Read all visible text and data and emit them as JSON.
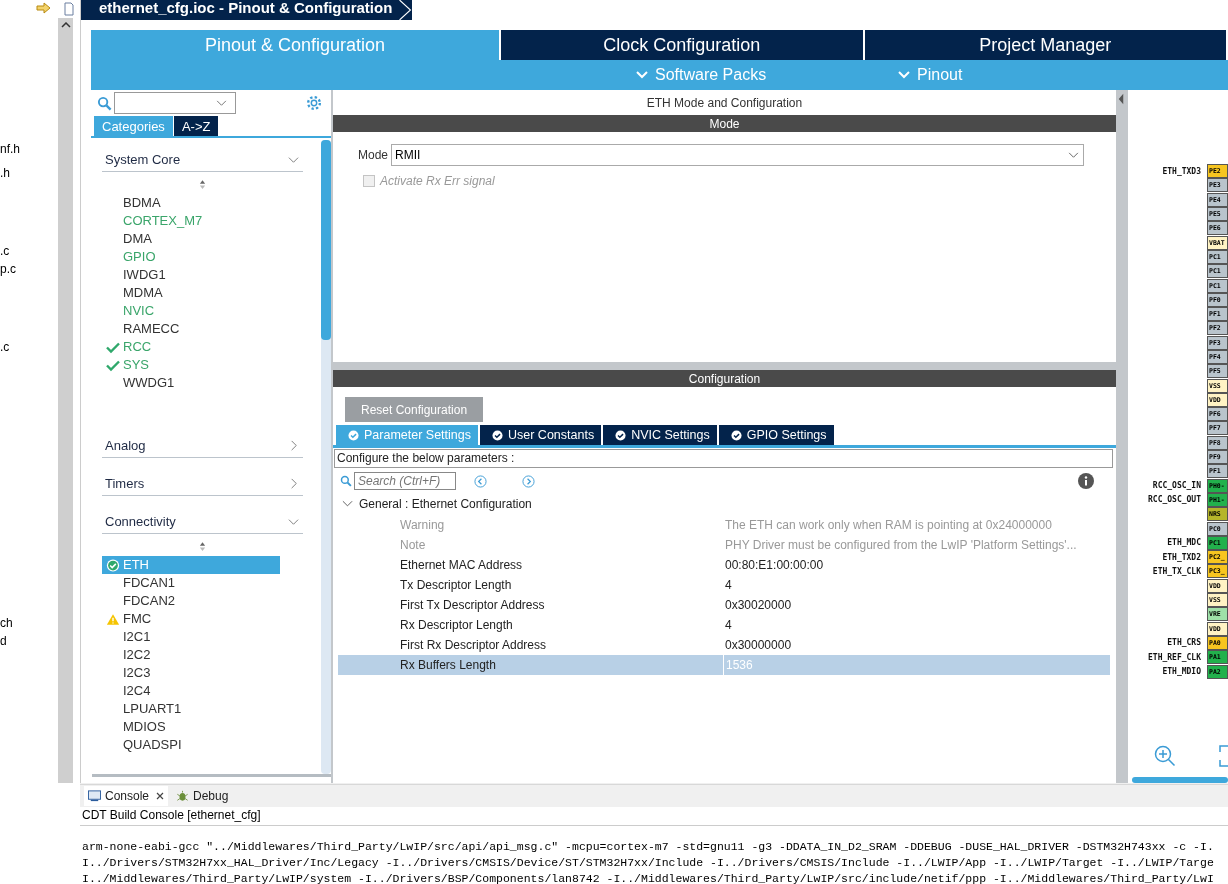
{
  "explorer": {
    "files": [
      "nf.h",
      ".h",
      ".c",
      "p.c",
      ".c",
      "ch",
      "d"
    ]
  },
  "window": {
    "title": "ethernet_cfg.ioc - Pinout & Configuration"
  },
  "tabs": [
    {
      "label": "Pinout & Configuration",
      "selected": true
    },
    {
      "label": "Clock Configuration",
      "selected": false
    },
    {
      "label": "Project Manager",
      "selected": false
    }
  ],
  "subtabs": [
    "Software Packs",
    "Pinout"
  ],
  "sidebar": {
    "view_tabs": [
      {
        "label": "Categories",
        "selected": true
      },
      {
        "label": "A->Z",
        "selected": false
      }
    ],
    "categories": [
      {
        "label": "System Core",
        "expanded": true,
        "items": [
          {
            "label": "BDMA",
            "kind": "plain",
            "selected": false
          },
          {
            "label": "CORTEX_M7",
            "kind": "green",
            "selected": false
          },
          {
            "label": "DMA",
            "kind": "plain",
            "selected": false
          },
          {
            "label": "GPIO",
            "kind": "green",
            "selected": false
          },
          {
            "label": "IWDG1",
            "kind": "plain",
            "selected": false
          },
          {
            "label": "MDMA",
            "kind": "plain",
            "selected": false
          },
          {
            "label": "NVIC",
            "kind": "green",
            "selected": false
          },
          {
            "label": "RAMECC",
            "kind": "plain",
            "selected": false
          },
          {
            "label": "RCC",
            "kind": "checked",
            "selected": false
          },
          {
            "label": "SYS",
            "kind": "checked",
            "selected": false
          },
          {
            "label": "WWDG1",
            "kind": "plain",
            "selected": false
          }
        ]
      },
      {
        "label": "Analog",
        "expanded": false
      },
      {
        "label": "Timers",
        "expanded": false
      },
      {
        "label": "Connectivity",
        "expanded": true,
        "items": [
          {
            "label": "ETH",
            "kind": "configured",
            "selected": true
          },
          {
            "label": "FDCAN1",
            "kind": "plain",
            "selected": false
          },
          {
            "label": "FDCAN2",
            "kind": "plain",
            "selected": false
          },
          {
            "label": "FMC",
            "kind": "warning",
            "selected": false
          },
          {
            "label": "I2C1",
            "kind": "plain",
            "selected": false
          },
          {
            "label": "I2C2",
            "kind": "plain",
            "selected": false
          },
          {
            "label": "I2C3",
            "kind": "plain",
            "selected": false
          },
          {
            "label": "I2C4",
            "kind": "plain",
            "selected": false
          },
          {
            "label": "LPUART1",
            "kind": "plain",
            "selected": false
          },
          {
            "label": "MDIOS",
            "kind": "plain",
            "selected": false
          },
          {
            "label": "QUADSPI",
            "kind": "plain",
            "selected": false
          }
        ]
      }
    ]
  },
  "mode_panel": {
    "title": "ETH Mode and Configuration",
    "bar": "Mode",
    "mode_label": "Mode",
    "mode_value": "RMII",
    "checkbox": {
      "label": "Activate Rx Err signal",
      "checked": false,
      "disabled": true
    }
  },
  "config_panel": {
    "bar": "Configuration",
    "reset_button": "Reset Configuration",
    "tabs": [
      {
        "label": "Parameter Settings",
        "selected": true
      },
      {
        "label": "User Constants",
        "selected": false
      },
      {
        "label": "NVIC Settings",
        "selected": false
      },
      {
        "label": "GPIO Settings",
        "selected": false
      }
    ],
    "hint": "Configure the below parameters :",
    "search": {
      "placeholder": "Search (Ctrl+F)"
    },
    "group": {
      "label": "General : Ethernet Configuration",
      "expanded": true,
      "rows": [
        {
          "name": "Warning",
          "value": "The ETH can work only when RAM is pointing at 0x24000000",
          "disabled": true,
          "selected": false
        },
        {
          "name": "Note",
          "value": "PHY Driver must be configured from the LwIP 'Platform Settings'...",
          "disabled": true,
          "selected": false
        },
        {
          "name": "Ethernet MAC Address",
          "value": "00:80:E1:00:00:00",
          "disabled": false,
          "selected": false
        },
        {
          "name": "Tx Descriptor Length",
          "value": "4",
          "disabled": false,
          "selected": false
        },
        {
          "name": "First Tx Descriptor Address",
          "value": "0x30020000",
          "disabled": false,
          "selected": false
        },
        {
          "name": "Rx Descriptor Length",
          "value": "4",
          "disabled": false,
          "selected": false
        },
        {
          "name": "First Rx Descriptor Address",
          "value": "0x30000000",
          "disabled": false,
          "selected": false
        },
        {
          "name": "Rx Buffers Length",
          "value": "1536",
          "disabled": false,
          "selected": true
        }
      ]
    }
  },
  "pinout": {
    "pins": [
      {
        "label": "ETH_TXD3",
        "name": "PE2",
        "color": "#f7c520"
      },
      {
        "name": "PE3",
        "color": "#b9c4cc"
      },
      {
        "name": "PE4",
        "color": "#b9c4cc"
      },
      {
        "name": "PE5",
        "color": "#b9c4cc"
      },
      {
        "name": "PE6",
        "color": "#b9c4cc"
      },
      {
        "name": "VBAT",
        "color": "#fff3c4"
      },
      {
        "name": "PC1",
        "color": "#b9c4cc"
      },
      {
        "name": "PC1",
        "color": "#b9c4cc"
      },
      {
        "name": "PC1",
        "color": "#b9c4cc"
      },
      {
        "name": "PF0",
        "color": "#b9c4cc"
      },
      {
        "name": "PF1",
        "color": "#b9c4cc"
      },
      {
        "name": "PF2",
        "color": "#b9c4cc"
      },
      {
        "name": "PF3",
        "color": "#b9c4cc"
      },
      {
        "name": "PF4",
        "color": "#b9c4cc"
      },
      {
        "name": "PF5",
        "color": "#b9c4cc"
      },
      {
        "name": "VSS",
        "color": "#fff3c4"
      },
      {
        "name": "VDD",
        "color": "#fff3c4"
      },
      {
        "name": "PF6",
        "color": "#b9c4cc"
      },
      {
        "name": "PF7",
        "color": "#b9c4cc"
      },
      {
        "name": "PF8",
        "color": "#b9c4cc"
      },
      {
        "name": "PF9",
        "color": "#b9c4cc"
      },
      {
        "name": "PF1",
        "color": "#b9c4cc"
      },
      {
        "label": "RCC_OSC_IN",
        "name": "PH0-",
        "color": "#22b14c"
      },
      {
        "label": "RCC_OSC_OUT",
        "name": "PH1-",
        "color": "#22b14c"
      },
      {
        "name": "NRS",
        "color": "#b5b52a"
      },
      {
        "name": "PC0",
        "color": "#b9c4cc"
      },
      {
        "label": "ETH_MDC",
        "name": "PC1",
        "color": "#22b14c"
      },
      {
        "label": "ETH_TXD2",
        "name": "PC2_",
        "color": "#f7c520"
      },
      {
        "label": "ETH_TX_CLK",
        "name": "PC3_",
        "color": "#f7c520"
      },
      {
        "name": "VDD",
        "color": "#fff3c4"
      },
      {
        "name": "VSS",
        "color": "#fff3c4"
      },
      {
        "name": "VRE",
        "color": "#9fe0a8"
      },
      {
        "name": "VDD",
        "color": "#fff3c4"
      },
      {
        "label": "ETH_CRS",
        "name": "PA0",
        "color": "#f7c520"
      },
      {
        "label": "ETH_REF_CLK",
        "name": "PA1",
        "color": "#22b14c"
      },
      {
        "label": "ETH_MDIO",
        "name": "PA2",
        "color": "#22b14c"
      }
    ]
  },
  "console": {
    "tabs": [
      {
        "label": "Console",
        "selected": true
      },
      {
        "label": "Debug",
        "selected": false
      }
    ],
    "title": "CDT Build Console [ethernet_cfg]",
    "lines": [
      "arm-none-eabi-gcc \"../Middlewares/Third_Party/LwIP/src/api/api_msg.c\" -mcpu=cortex-m7 -std=gnu11 -g3 -DDATA_IN_D2_SRAM -DDEBUG -DUSE_HAL_DRIVER -DSTM32H743xx -c -I.",
      "I../Drivers/STM32H7xx_HAL_Driver/Inc/Legacy -I../Drivers/CMSIS/Device/ST/STM32H7xx/Include -I../Drivers/CMSIS/Include -I../LWIP/App -I../LWIP/Target -I../LWIP/Targe",
      "I../Middlewares/Third_Party/LwIP/system -I../Drivers/BSP/Components/lan8742 -I../Middlewares/Third_Party/LwIP/src/include/netif/ppp -I../Middlewares/Third_Party/LwI"
    ]
  }
}
